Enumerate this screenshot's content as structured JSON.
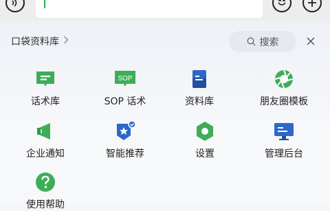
{
  "top_bar": {
    "voice_icon": "voice-icon",
    "emoji_icon": "emoji-icon",
    "plus_icon": "plus-icon"
  },
  "panel": {
    "library_title": "口袋资料库",
    "search_placeholder": "搜索",
    "items": [
      {
        "label": "话术库",
        "icon": "speech-icon",
        "color": "#3dad58"
      },
      {
        "label": "SOP 话术",
        "icon": "sop-icon",
        "color": "#3dad58"
      },
      {
        "label": "资料库",
        "icon": "folder-icon",
        "color": "#2f67c8"
      },
      {
        "label": "朋友圈模板",
        "icon": "aperture-icon",
        "color": "#3dad58"
      },
      {
        "label": "企业通知",
        "icon": "megaphone-icon",
        "color": "#3dad58"
      },
      {
        "label": "智能推荐",
        "icon": "star-badge-icon",
        "color": "#2f67c8"
      },
      {
        "label": "设置",
        "icon": "settings-icon",
        "color": "#3dad58"
      },
      {
        "label": "管理后台",
        "icon": "monitor-icon",
        "color": "#2f67c8"
      },
      {
        "label": "使用帮助",
        "icon": "help-icon",
        "color": "#3dad58"
      }
    ],
    "sop_icon_text": "SOP"
  }
}
